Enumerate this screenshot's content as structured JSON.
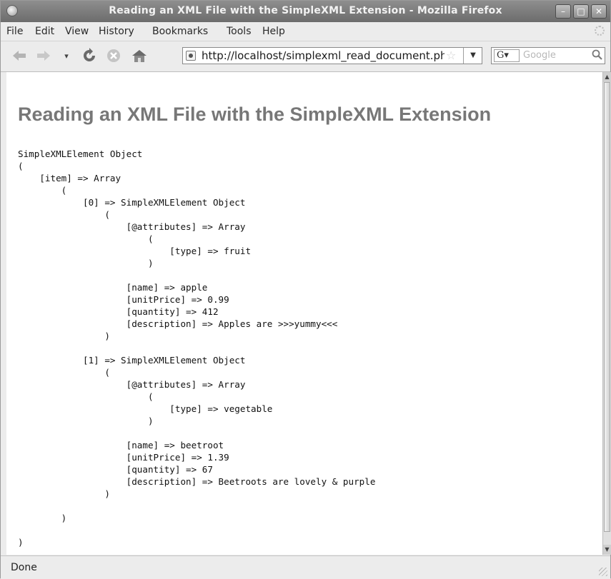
{
  "window": {
    "title": "Reading an XML File with the SimpleXML Extension - Mozilla Firefox",
    "controls": {
      "minimize": "–",
      "maximize": "□",
      "close": "✕"
    }
  },
  "menu": [
    "File",
    "Edit",
    "View",
    "History",
    "Bookmarks",
    "Tools",
    "Help"
  ],
  "nav": {
    "back_icon": "back-arrow",
    "forward_icon": "forward-arrow",
    "history_dropdown": "▾",
    "reload_icon": "reload",
    "stop_icon": "stop",
    "home_icon": "home",
    "url": "http://localhost/simplexml_read_document.ph",
    "url_dropdown": "▼",
    "bookmark_star": "☆",
    "search": {
      "engine": "G▾",
      "placeholder": "Google"
    }
  },
  "page": {
    "heading": "Reading an XML File with the SimpleXML Extension",
    "output": "SimpleXMLElement Object\n(\n    [item] => Array\n        (\n            [0] => SimpleXMLElement Object\n                (\n                    [@attributes] => Array\n                        (\n                            [type] => fruit\n                        )\n\n                    [name] => apple\n                    [unitPrice] => 0.99\n                    [quantity] => 412\n                    [description] => Apples are >>>yummy<<<\n                )\n\n            [1] => SimpleXMLElement Object\n                (\n                    [@attributes] => Array\n                        (\n                            [type] => vegetable\n                        )\n\n                    [name] => beetroot\n                    [unitPrice] => 1.39\n                    [quantity] => 67\n                    [description] => Beetroots are lovely & purple\n                )\n\n        )\n\n)"
  },
  "status": {
    "text": "Done"
  }
}
